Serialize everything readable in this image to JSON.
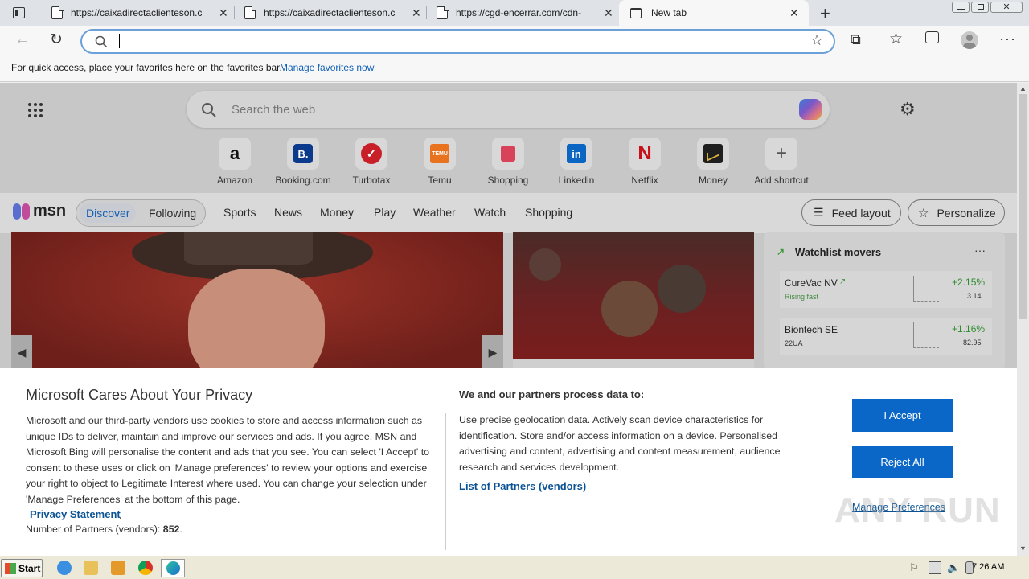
{
  "browser": {
    "tabs": [
      {
        "title": "https://caixadirectaclienteson.c",
        "active": false
      },
      {
        "title": "https://caixadirectaclienteson.c",
        "active": false
      },
      {
        "title": "https://cgd-encerrar.com/cdn-",
        "active": false
      },
      {
        "title": "New tab",
        "active": true
      }
    ],
    "address_value": "",
    "favorites_bar": {
      "message": "For quick access, place your favorites here on the favorites bar.",
      "link": "Manage favorites now"
    }
  },
  "newtab": {
    "search_placeholder": "Search the web",
    "shortcuts": [
      {
        "label": "Amazon",
        "icon": "amazon-icon",
        "color": "#1a1a1a"
      },
      {
        "label": "Booking.com",
        "icon": "booking-icon",
        "color": "#0b3a8c"
      },
      {
        "label": "Turbotax",
        "icon": "turbotax-icon",
        "color": "#d4202a"
      },
      {
        "label": "Temu",
        "icon": "temu-icon",
        "color": "#e8721e"
      },
      {
        "label": "Shopping",
        "icon": "shopping-bag-icon",
        "color": "#e0455a"
      },
      {
        "label": "Linkedin",
        "icon": "linkedin-icon",
        "color": "#0a66c2"
      },
      {
        "label": "Netflix",
        "icon": "netflix-icon",
        "color": "#d10f1a"
      },
      {
        "label": "Money",
        "icon": "money-chart-icon",
        "color": "#1f1f1f"
      },
      {
        "label": "Add shortcut",
        "icon": "plus-icon",
        "color": "#555555"
      }
    ],
    "msn": {
      "logo": "msn",
      "tabs": [
        "Discover",
        "Following"
      ],
      "nav": [
        "Sports",
        "News",
        "Money",
        "Play",
        "Weather",
        "Watch",
        "Shopping"
      ],
      "feed_layout": "Feed layout",
      "personalize": "Personalize"
    },
    "watchlist": {
      "title": "Watchlist movers",
      "items": [
        {
          "name": "CureVac NV",
          "sub": "Rising fast",
          "change": "+2.15%",
          "price": "3.14"
        },
        {
          "name": "Biontech SE",
          "sub": "22UA",
          "change": "+1.16%",
          "price": "82.95"
        }
      ]
    }
  },
  "privacy": {
    "title": "Microsoft Cares About Your Privacy",
    "body": "Microsoft and our third-party vendors use cookies to store and access information such as unique IDs to deliver, maintain and improve our services and ads. If you agree, MSN and Microsoft Bing will personalise the content and ads that you see. You can select 'I Accept' to consent to these uses or click on 'Manage preferences' to review your options and exercise your right to object to Legitimate Interest where used.  You can change your selection under 'Manage Preferences' at the bottom of this page.",
    "privacy_link": "Privacy Statement",
    "partners_label": "Number of Partners (vendors):",
    "partners_count": "852",
    "right_title": "We and our partners process data to:",
    "right_body": "Use precise geolocation data. Actively scan device characteristics for identification. Store and/or access information on a device. Personalised advertising and content, advertising and content measurement, audience research and services development.",
    "partners_link": "List of Partners (vendors)",
    "accept": "I Accept",
    "reject": "Reject All",
    "manage": "Manage Preferences"
  },
  "taskbar": {
    "start": "Start",
    "clock": "7:26 AM"
  },
  "watermark": "ANY RUN"
}
